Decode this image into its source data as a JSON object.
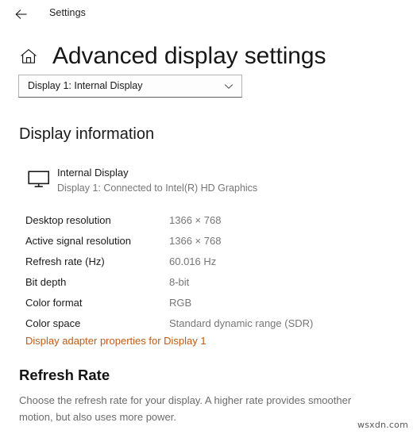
{
  "titlebar": {
    "back_icon": "back-arrow-icon",
    "app_name": "Settings"
  },
  "header": {
    "home_icon": "home-icon",
    "title": "Advanced display settings"
  },
  "display_selector": {
    "selected": "Display 1: Internal Display",
    "chevron_icon": "chevron-down-icon",
    "options": [
      "Display 1: Internal Display"
    ]
  },
  "display_information": {
    "heading": "Display information",
    "monitor": {
      "icon": "monitor-icon",
      "name": "Internal Display",
      "subtitle": "Display 1: Connected to Intel(R) HD Graphics"
    },
    "rows": [
      {
        "label": "Desktop resolution",
        "value": "1366 × 768"
      },
      {
        "label": "Active signal resolution",
        "value": "1366 × 768"
      },
      {
        "label": "Refresh rate (Hz)",
        "value": "60.016 Hz"
      },
      {
        "label": "Bit depth",
        "value": "8-bit"
      },
      {
        "label": "Color format",
        "value": "RGB"
      },
      {
        "label": "Color space",
        "value": "Standard dynamic range (SDR)"
      }
    ],
    "adapter_link": "Display adapter properties for Display 1"
  },
  "refresh_rate": {
    "heading": "Refresh Rate",
    "description": "Choose the refresh rate for your display. A higher rate provides smoother motion, but also uses more power."
  },
  "watermark": "wsxdn.com",
  "colors": {
    "accent_link": "#c15a15",
    "label_text": "#1a1a1a",
    "value_text": "#767676",
    "background": "#ffffff"
  }
}
